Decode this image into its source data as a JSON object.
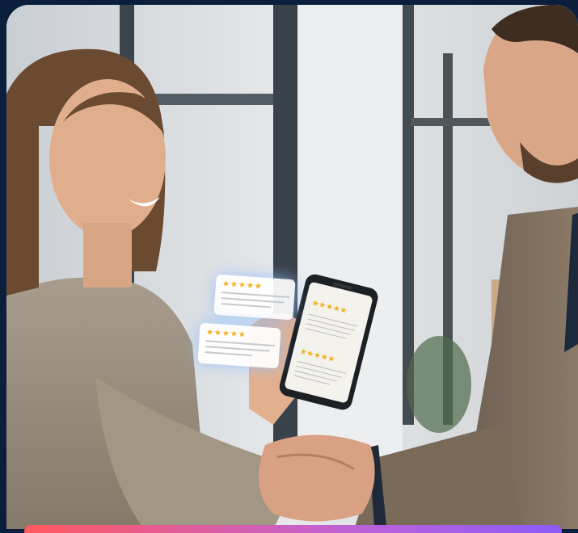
{
  "review_cards": [
    {
      "stars": "★★★★★",
      "text": ""
    },
    {
      "stars": "★★★★★",
      "text": ""
    }
  ],
  "phone_reviews": [
    {
      "stars": "★★★★★"
    },
    {
      "stars": "★★★★★"
    }
  ],
  "colors": {
    "background": "#0b1f3d",
    "star": "#f2b01e",
    "accent_gradient_start": "#ff5a5f",
    "accent_gradient_end": "#8b5cf6"
  }
}
